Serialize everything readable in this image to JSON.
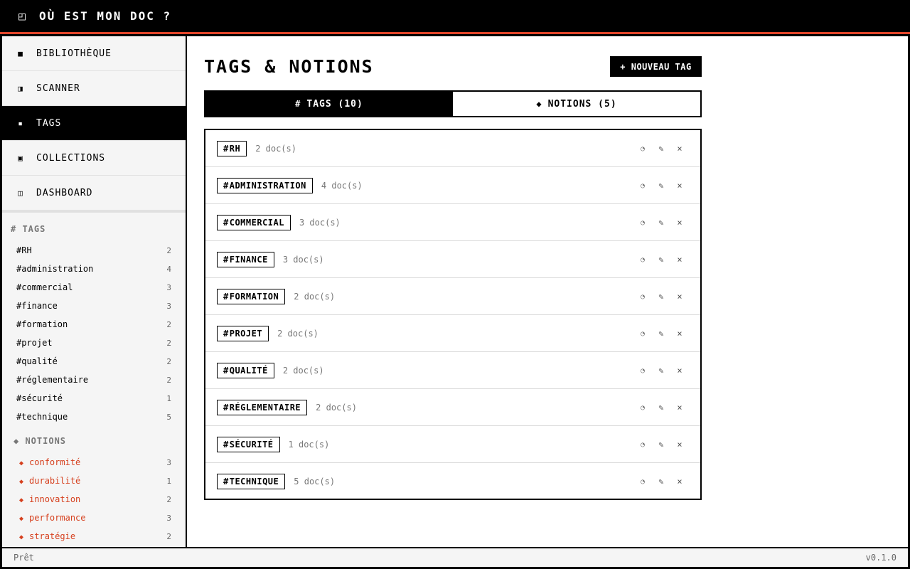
{
  "app": {
    "title": "OÙ EST MON DOC ?",
    "logo_glyph": "◰"
  },
  "nav": [
    {
      "icon": "■",
      "icon_name": "library-icon",
      "label": "BIBLIOTHÈQUE",
      "active": false
    },
    {
      "icon": "◨",
      "icon_name": "scanner-icon",
      "label": "SCANNER",
      "active": false
    },
    {
      "icon": "▪",
      "icon_name": "tags-icon",
      "label": "TAGS",
      "active": true
    },
    {
      "icon": "▣",
      "icon_name": "collections-icon",
      "label": "COLLECTIONS",
      "active": false
    },
    {
      "icon": "◫",
      "icon_name": "dashboard-icon",
      "label": "DASHBOARD",
      "active": false
    }
  ],
  "sidebar": {
    "tags_heading": "# TAGS",
    "tags": [
      {
        "label": "#RH",
        "count": "2"
      },
      {
        "label": "#administration",
        "count": "4"
      },
      {
        "label": "#commercial",
        "count": "3"
      },
      {
        "label": "#finance",
        "count": "3"
      },
      {
        "label": "#formation",
        "count": "2"
      },
      {
        "label": "#projet",
        "count": "2"
      },
      {
        "label": "#qualité",
        "count": "2"
      },
      {
        "label": "#réglementaire",
        "count": "2"
      },
      {
        "label": "#sécurité",
        "count": "1"
      },
      {
        "label": "#technique",
        "count": "5"
      }
    ],
    "notions_heading": "◆ NOTIONS",
    "notion_glyph": "◆",
    "notions": [
      {
        "label": "conformité",
        "count": "3"
      },
      {
        "label": "durabilité",
        "count": "1"
      },
      {
        "label": "innovation",
        "count": "2"
      },
      {
        "label": "performance",
        "count": "3"
      },
      {
        "label": "stratégie",
        "count": "2"
      }
    ]
  },
  "main": {
    "title": "TAGS & NOTIONS",
    "new_button": "+ NOUVEAU TAG",
    "tabs": [
      {
        "icon": "#",
        "label": "TAGS (10)",
        "active": true
      },
      {
        "icon": "◆",
        "label": "NOTIONS (5)",
        "active": false
      }
    ],
    "tag_rows": [
      {
        "name": "RH",
        "docs": "2 doc(s)"
      },
      {
        "name": "ADMINISTRATION",
        "docs": "4 doc(s)"
      },
      {
        "name": "COMMERCIAL",
        "docs": "3 doc(s)"
      },
      {
        "name": "FINANCE",
        "docs": "3 doc(s)"
      },
      {
        "name": "FORMATION",
        "docs": "2 doc(s)"
      },
      {
        "name": "PROJET",
        "docs": "2 doc(s)"
      },
      {
        "name": "QUALITÉ",
        "docs": "2 doc(s)"
      },
      {
        "name": "RÉGLEMENTAIRE",
        "docs": "2 doc(s)"
      },
      {
        "name": "SÉCURITÉ",
        "docs": "1 doc(s)"
      },
      {
        "name": "TECHNIQUE",
        "docs": "5 doc(s)"
      }
    ],
    "row_actions": {
      "merge": "◔",
      "edit": "✎",
      "delete": "×"
    }
  },
  "status": {
    "left": "Prêt",
    "version": "v0.1.0"
  },
  "colors": {
    "accent": "#e2452a",
    "notion": "#d6401e",
    "dark": "#000000",
    "panel": "#f5f5f5"
  }
}
